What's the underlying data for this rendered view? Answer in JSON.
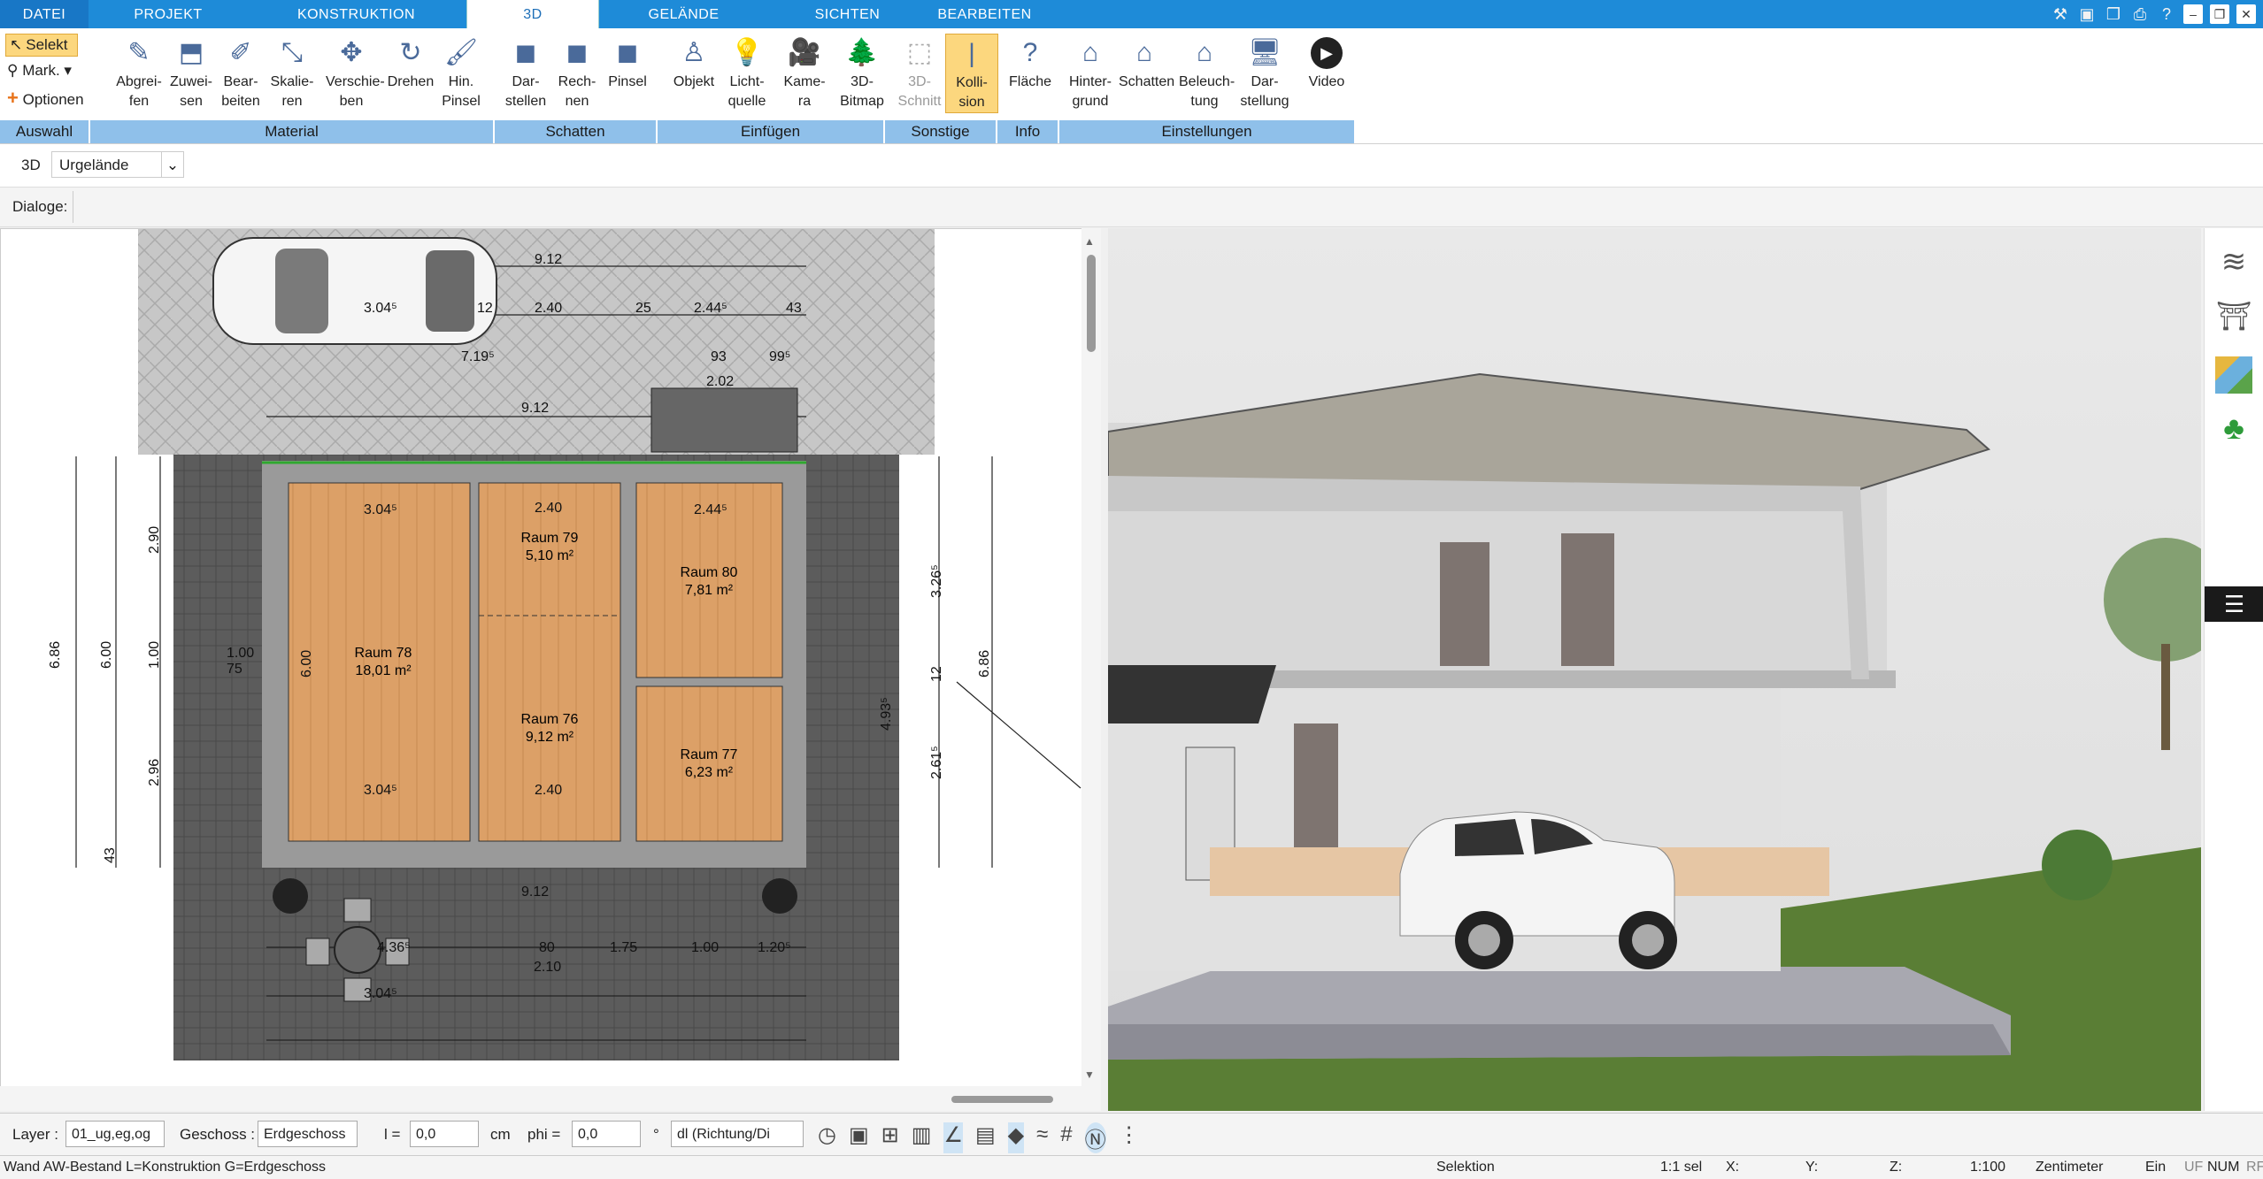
{
  "tabs": [
    "DATEI",
    "PROJEKT",
    "KONSTRUKTION",
    "3D",
    "GELÄNDE",
    "SICHTEN",
    "BEARBEITEN"
  ],
  "ribbon": {
    "auswahl": {
      "selekt": "Selekt",
      "mark": "Mark.",
      "optionen": "Optionen",
      "group": "Auswahl"
    },
    "material": {
      "group": "Material",
      "buttons": [
        [
          "Abgrei-",
          "fen"
        ],
        [
          "Zuwei-",
          "sen"
        ],
        [
          "Bear-",
          "beiten"
        ],
        [
          "Skalie-",
          "ren"
        ],
        [
          "Verschie-",
          "ben"
        ],
        [
          "Drehen",
          ""
        ],
        [
          "Hin.",
          "Pinsel"
        ]
      ]
    },
    "schatten": {
      "group": "Schatten",
      "buttons": [
        [
          "Dar-",
          "stellen"
        ],
        [
          "Rech-",
          "nen"
        ],
        [
          "Pinsel",
          ""
        ]
      ]
    },
    "einfuegen": {
      "group": "Einfügen",
      "buttons": [
        [
          "Objekt",
          ""
        ],
        [
          "Licht-",
          "quelle"
        ],
        [
          "Kame-",
          "ra"
        ],
        [
          "3D-",
          "Bitmap"
        ]
      ]
    },
    "sonstige": {
      "group": "Sonstige",
      "buttons": [
        [
          "3D-",
          "Schnitt"
        ],
        [
          "Kolli-",
          "sion"
        ]
      ]
    },
    "info": {
      "group": "Info",
      "buttons": [
        [
          "Fläche",
          ""
        ]
      ]
    },
    "einstellungen": {
      "group": "Einstellungen",
      "buttons": [
        [
          "Hinter-",
          "grund"
        ],
        [
          "Schatten",
          ""
        ],
        [
          "Beleuch-",
          "tung"
        ],
        [
          "Dar-",
          "stellung"
        ],
        [
          "Video",
          ""
        ]
      ]
    }
  },
  "row2": {
    "mode": "3D",
    "terrain": "Urgelände"
  },
  "row3": {
    "label": "Dialoge:"
  },
  "plan": {
    "rooms": [
      {
        "name": "Raum 78",
        "area": "18,01 m²"
      },
      {
        "name": "Raum 79",
        "area": "5,10 m²"
      },
      {
        "name": "Raum 80",
        "area": "7,81 m²"
      },
      {
        "name": "Raum 76",
        "area": "9,12 m²"
      },
      {
        "name": "Raum 77",
        "area": "6,23 m²"
      }
    ],
    "dims": [
      "9.12",
      "3.04⁵",
      "2.40",
      "25",
      "2.44⁵",
      "43",
      "12",
      "7.19⁵",
      "93",
      "99⁵",
      "2.02",
      "9.12",
      "3.04⁵",
      "2.40",
      "2.44⁵",
      "6.86",
      "6.00",
      "2.90",
      "1.00",
      "2.96",
      "43",
      "1.00",
      "75",
      "6.00",
      "6.86",
      "3.26⁵",
      "4.93⁵",
      "2.61⁵",
      "12",
      "3.04⁵",
      "2.40",
      "9.12",
      "1.75",
      "1.00",
      "1.20⁵",
      "80",
      "2.10",
      "4.36⁵",
      "3.04⁵"
    ]
  },
  "bottombar": {
    "layer_label": "Layer :",
    "layer_value": "01_ug,eg,og",
    "geschoss_label": "Geschoss :",
    "geschoss_value": "Erdgeschoss",
    "l_label": "l =",
    "l_value": "0,0",
    "l_unit": "cm",
    "phi_label": "phi =",
    "phi_value": "0,0",
    "phi_unit": "°",
    "dl_value": "dl (Richtung/Di"
  },
  "status": {
    "left": "Wand AW-Bestand L=Konstruktion G=Erdgeschoss",
    "mode": "Selektion",
    "scale_sel": "1:1 sel",
    "x": "X:",
    "y": "Y:",
    "z": "Z:",
    "scale": "1:100",
    "unit": "Zentimeter",
    "ein": "Ein",
    "uf": "UF",
    "num": "NUM",
    "rf": "RF"
  }
}
